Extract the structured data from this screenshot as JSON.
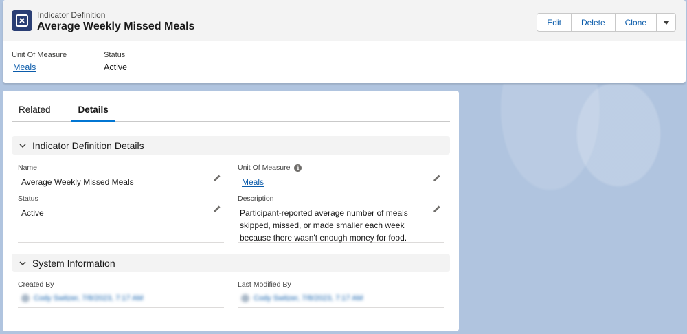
{
  "header": {
    "object_type": "Indicator Definition",
    "title": "Average Weekly Missed Meals",
    "buttons": {
      "edit": "Edit",
      "delete": "Delete",
      "clone": "Clone"
    },
    "highlights": [
      {
        "label": "Unit Of Measure",
        "value": "Meals"
      },
      {
        "label": "Status",
        "value": "Active"
      }
    ]
  },
  "tabs": [
    {
      "label": "Related",
      "active": false
    },
    {
      "label": "Details",
      "active": true
    }
  ],
  "sections": {
    "details": {
      "title": "Indicator Definition Details",
      "fields": {
        "name": {
          "label": "Name",
          "value": "Average Weekly Missed Meals"
        },
        "unit": {
          "label": "Unit Of Measure",
          "value": "Meals"
        },
        "status": {
          "label": "Status",
          "value": "Active"
        },
        "description": {
          "label": "Description",
          "value": "Participant-reported average number of meals skipped, missed, or made smaller each week because there wasn't enough money for food."
        }
      }
    },
    "system": {
      "title": "System Information",
      "fields": {
        "created_by": {
          "label": "Created By",
          "value": "Cody Switzer, 7/8/2023, 7:17 AM"
        },
        "modified_by": {
          "label": "Last Modified By",
          "value": "Cody Switzer, 7/8/2023, 7:17 AM"
        }
      }
    }
  },
  "colors": {
    "brand": "#0176d3",
    "link": "#0b5cab",
    "icon_bg": "#2a3e74",
    "background": "#b0c4df"
  }
}
